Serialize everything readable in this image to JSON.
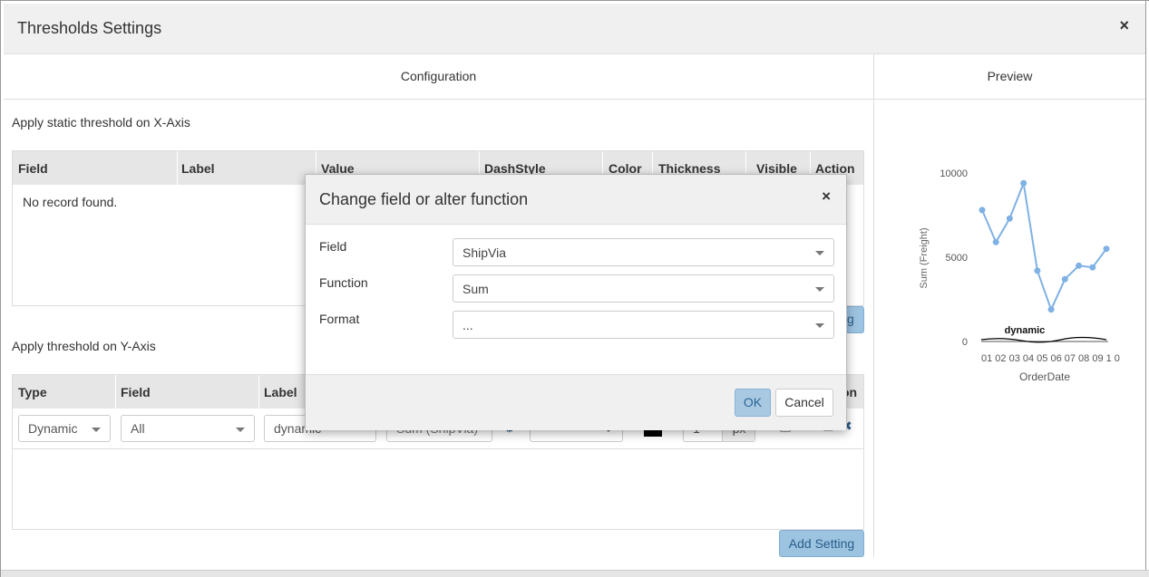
{
  "outer_modal": {
    "title": "Thresholds Settings",
    "close_glyph": "×"
  },
  "columns": {
    "configuration": "Configuration",
    "preview": "Preview"
  },
  "x_axis": {
    "title": "Apply static threshold on X-Axis",
    "headers": [
      "Field",
      "Label",
      "Value",
      "DashStyle",
      "Color",
      "Thickness",
      "Visible",
      "Action"
    ],
    "empty_text": "No record found."
  },
  "y_axis": {
    "title": "Apply threshold on Y-Axis",
    "headers": [
      "Type",
      "Field",
      "Label",
      "on"
    ],
    "row": {
      "type": "Dynamic",
      "field": "All",
      "label": "dynamic",
      "function": "Sum (ShipVia)",
      "unit": "px",
      "thickness": "1"
    },
    "add_button": "Add Setting"
  },
  "dialog": {
    "title": "Change field or alter function",
    "close_glyph": "×",
    "field_label": "Field",
    "field_value": "ShipVia",
    "function_label": "Function",
    "function_value": "Sum",
    "format_label": "Format",
    "format_value": "...",
    "ok": "OK",
    "cancel": "Cancel"
  },
  "colors": {
    "line": "#7fb1e4",
    "header_bg": "#e6e6e6",
    "button_light": "#9cc3e0",
    "threshold_color": "#000000"
  },
  "chart_data": {
    "type": "line",
    "xlabel": "OrderDate",
    "ylabel": "Sum (Freight)",
    "categories": [
      "01",
      "02",
      "03",
      "04",
      "05",
      "06",
      "07",
      "08",
      "09",
      "10"
    ],
    "x_tick_text": "01 02 03 04 05 06 07 08 09 1 0",
    "y_ticks": [
      "10000",
      "5000",
      "0"
    ],
    "ylim": [
      0,
      10000
    ],
    "series": [
      {
        "values": [
          7800,
          5900,
          7300,
          9400,
          4200,
          1900,
          3700,
          4500,
          4400,
          5500
        ]
      }
    ],
    "threshold": {
      "label": "dynamic"
    }
  }
}
